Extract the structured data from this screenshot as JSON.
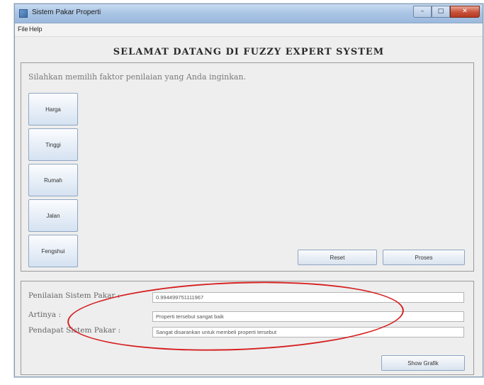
{
  "window": {
    "title": "Sistem Pakar Properti"
  },
  "menu": [
    {
      "label": "File"
    },
    {
      "label": "Help"
    }
  ],
  "headline": "SELAMAT DATANG DI FUZZY EXPERT SYSTEM",
  "instruction": "Silahkan memilih faktor penilaian yang Anda inginkan.",
  "factors": [
    {
      "label": "Harga"
    },
    {
      "label": "Tinggi"
    },
    {
      "label": "Rumah"
    },
    {
      "label": "Jalan"
    },
    {
      "label": "Fengshui"
    }
  ],
  "actions": {
    "reset": "Reset",
    "process": "Proses"
  },
  "results": {
    "score_label": "Penilaian Sistem Pakar :",
    "score_value": "0.994499751111967",
    "meaning_label": "Artinya :",
    "meaning_value": "Properti tersebut sangat baik",
    "opinion_label": "Pendapat Sistem Pakar :",
    "opinion_value": "Sangat disarankan untuk membeli properti tersebut"
  },
  "show_graph": "Show Grafik",
  "colors": {
    "annotation": "#d62020",
    "titlebar": "#a9c4e4",
    "close": "#c8513a"
  }
}
